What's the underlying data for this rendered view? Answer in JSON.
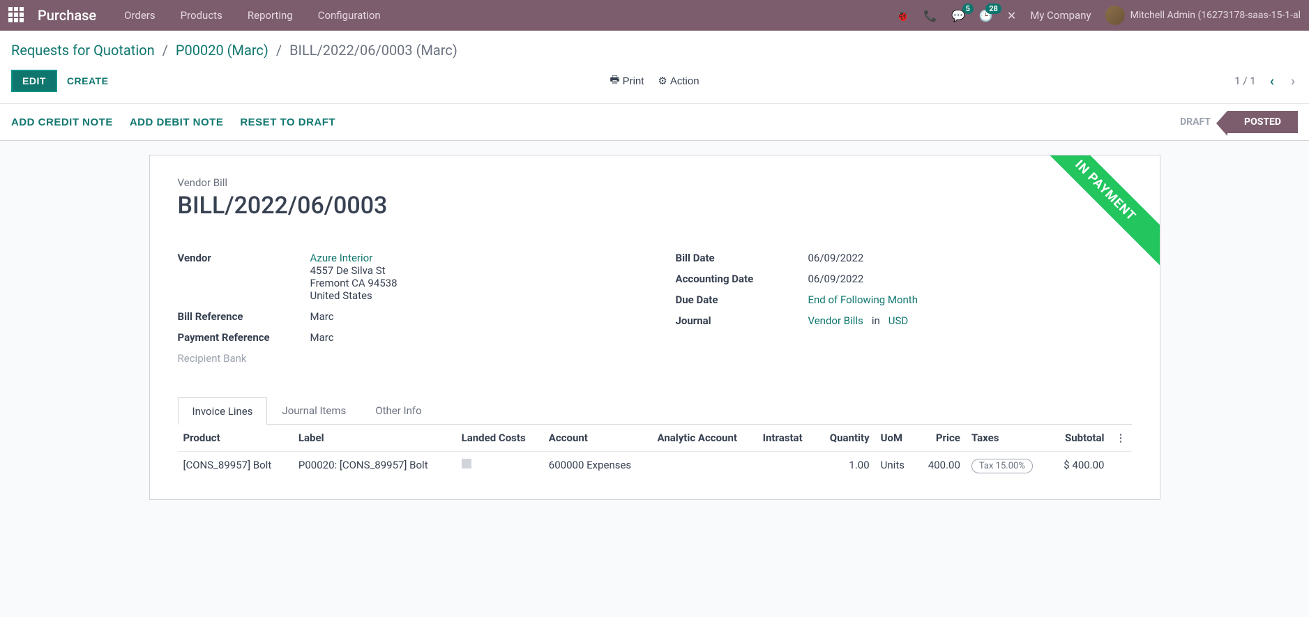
{
  "topnav": {
    "brand": "Purchase",
    "menu": [
      "Orders",
      "Products",
      "Reporting",
      "Configuration"
    ],
    "msg_badge": "5",
    "activity_badge": "28",
    "company": "My Company",
    "user": "Mitchell Admin (16273178-saas-15-1-al"
  },
  "breadcrumb": {
    "items": [
      "Requests for Quotation",
      "P00020 (Marc)"
    ],
    "current": "BILL/2022/06/0003 (Marc)"
  },
  "control": {
    "edit": "EDIT",
    "create": "CREATE",
    "print": "Print",
    "action": "Action",
    "pager": "1 / 1"
  },
  "statusbar": {
    "actions": [
      "ADD CREDIT NOTE",
      "ADD DEBIT NOTE",
      "RESET TO DRAFT"
    ],
    "steps": {
      "draft": "DRAFT",
      "posted": "POSTED"
    }
  },
  "bill": {
    "ribbon": "IN PAYMENT",
    "doc_type": "Vendor Bill",
    "doc_name": "BILL/2022/06/0003",
    "vendor_label": "Vendor",
    "vendor_name": "Azure Interior",
    "vendor_addr1": "4557 De Silva St",
    "vendor_addr2": "Fremont CA 94538",
    "vendor_addr3": "United States",
    "billref_label": "Bill Reference",
    "billref": "Marc",
    "payref_label": "Payment Reference",
    "payref": "Marc",
    "recipbank_label": "Recipient Bank",
    "billdate_label": "Bill Date",
    "billdate": "06/09/2022",
    "accdate_label": "Accounting Date",
    "accdate": "06/09/2022",
    "duedate_label": "Due Date",
    "duedate": "End of Following Month",
    "journal_label": "Journal",
    "journal": "Vendor Bills",
    "journal_in": "in",
    "journal_cur": "USD"
  },
  "tabs": [
    "Invoice Lines",
    "Journal Items",
    "Other Info"
  ],
  "table": {
    "headers": {
      "product": "Product",
      "label": "Label",
      "landed": "Landed Costs",
      "account": "Account",
      "analytic": "Analytic Account",
      "intrastat": "Intrastat",
      "qty": "Quantity",
      "uom": "UoM",
      "price": "Price",
      "taxes": "Taxes",
      "subtotal": "Subtotal"
    },
    "row": {
      "product": "[CONS_89957] Bolt",
      "label": "P00020: [CONS_89957] Bolt",
      "account": "600000 Expenses",
      "qty": "1.00",
      "uom": "Units",
      "price": "400.00",
      "tax": "Tax 15.00%",
      "subtotal": "$ 400.00"
    }
  }
}
